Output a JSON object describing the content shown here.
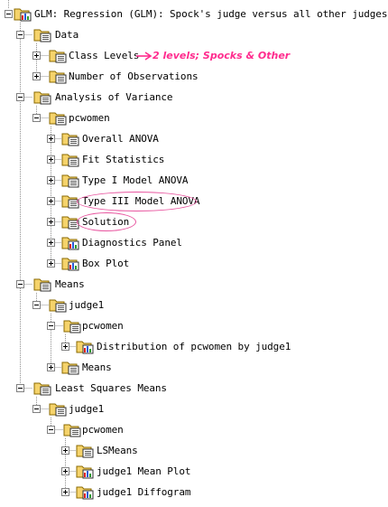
{
  "root": {
    "label": "GLM:  Regression (GLM): Spock's judge versus all other judges"
  },
  "data_section": {
    "label": "Data",
    "items": [
      {
        "label": "Class Levels"
      },
      {
        "label": "Number of Observations"
      }
    ]
  },
  "anova_section": {
    "label": "Analysis of Variance",
    "group": "pcwomen",
    "items": [
      {
        "label": "Overall ANOVA"
      },
      {
        "label": "Fit Statistics"
      },
      {
        "label": "Type I Model ANOVA"
      },
      {
        "label": "Type III Model ANOVA"
      },
      {
        "label": "Solution"
      },
      {
        "label": "Diagnostics Panel"
      },
      {
        "label": "Box Plot"
      }
    ]
  },
  "means_section": {
    "label": "Means",
    "group": "judge1",
    "subgroup": "pcwomen",
    "distribution": "Distribution of pcwomen by judge1",
    "means": "Means"
  },
  "lsmeans_section": {
    "label": "Least Squares Means",
    "group": "judge1",
    "subgroup": "pcwomen",
    "items": [
      {
        "label": "LSMeans"
      },
      {
        "label": "judge1 Mean Plot"
      },
      {
        "label": "judge1 Diffogram"
      }
    ]
  },
  "annotation": {
    "text": "2 levels; Spocks & Other",
    "color": "#ff2c8e"
  },
  "colors": {
    "tree_line": "#808080",
    "folder_yellow": "#f5d36b",
    "highlight_circle": "#e8559f"
  }
}
